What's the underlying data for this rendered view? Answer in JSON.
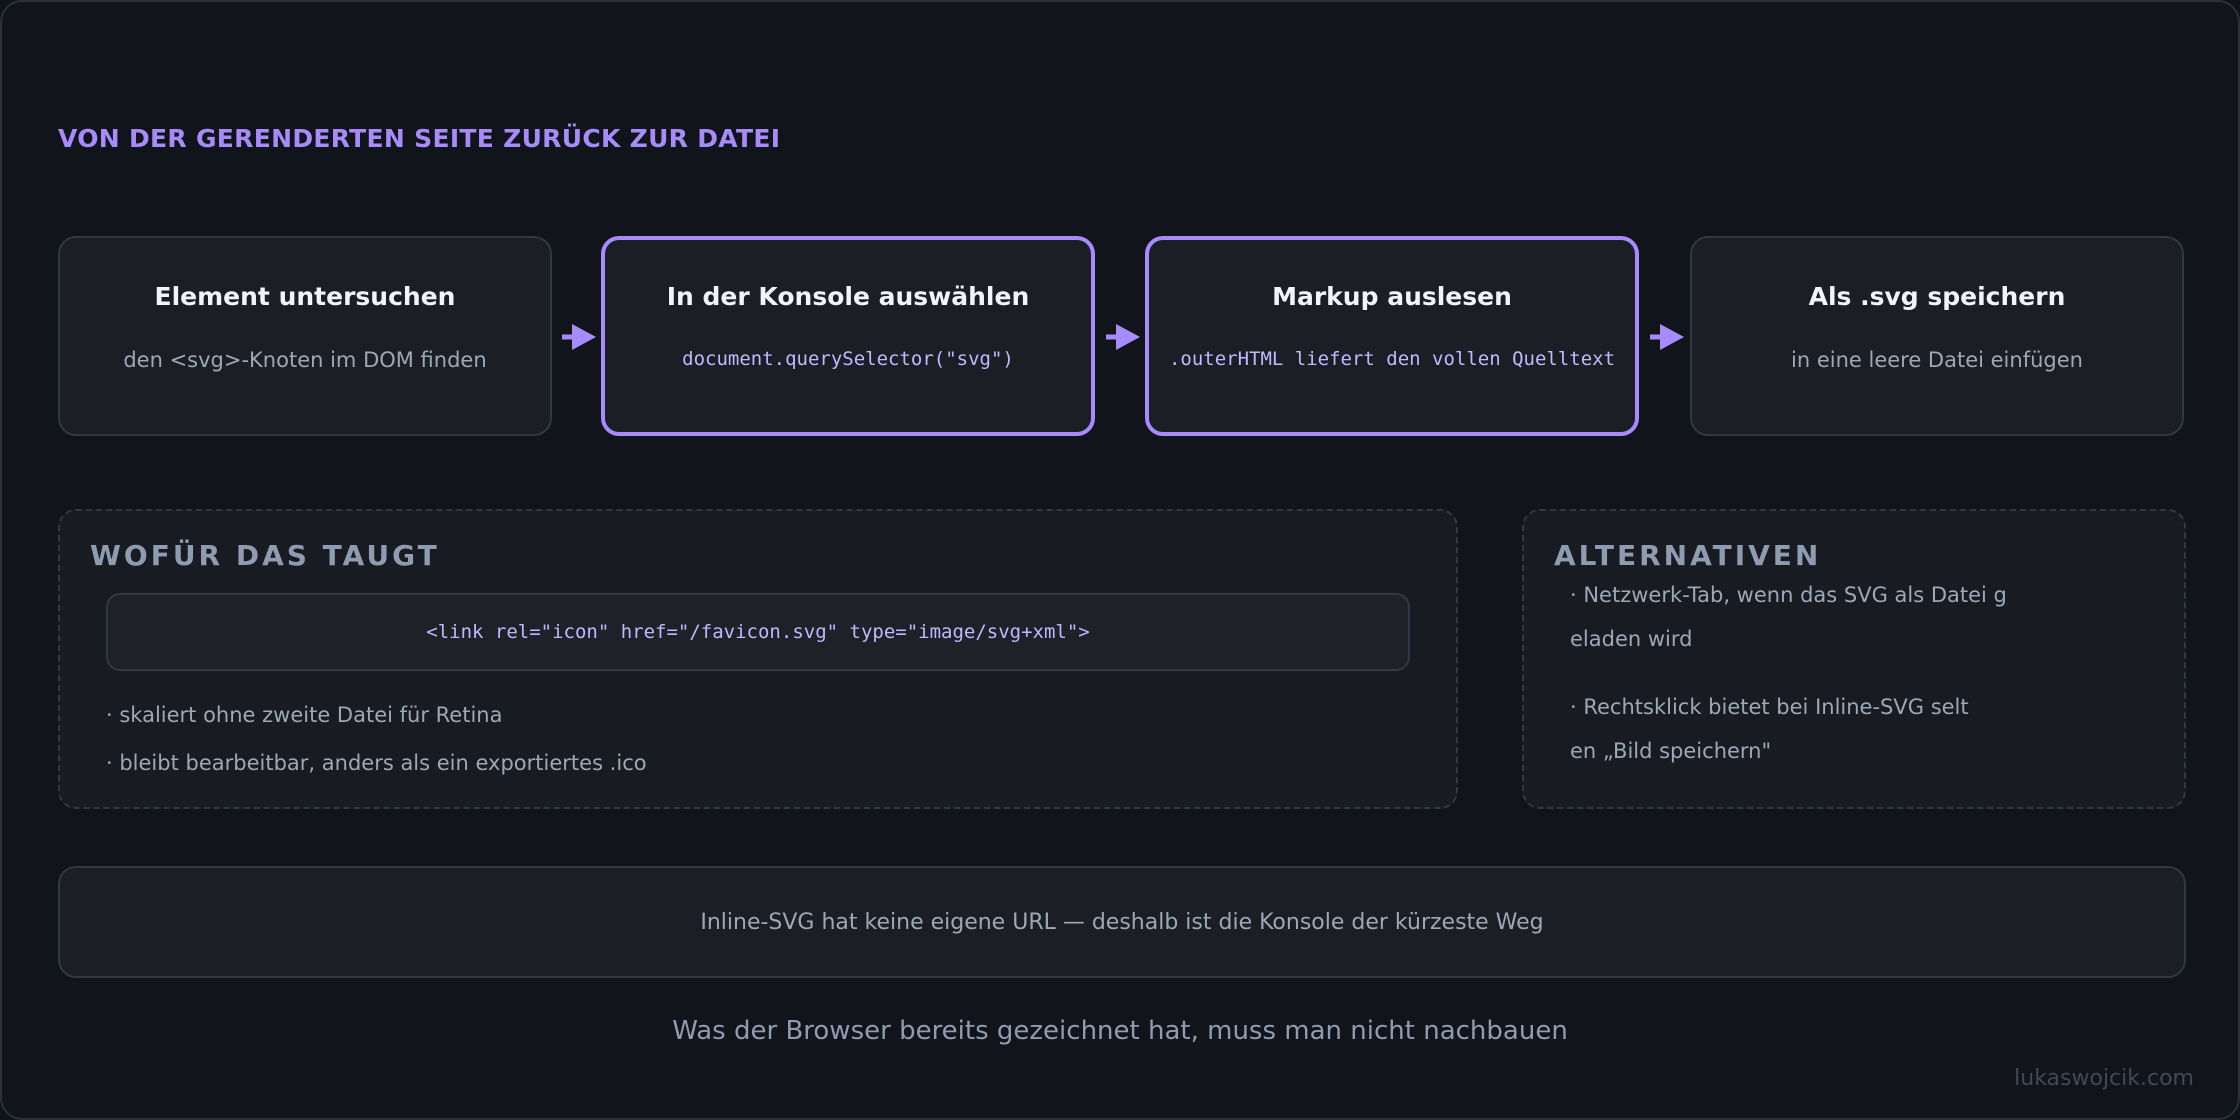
{
  "heading": "VON DER GERENDERTEN SEITE ZURÜCK ZUR DATEI",
  "steps": [
    {
      "title": "Element untersuchen",
      "desc": "den <svg>-Knoten im DOM finden"
    },
    {
      "title": "In der Konsole auswählen",
      "desc": "document.querySelector(\"svg\")"
    },
    {
      "title": "Markup auslesen",
      "desc": ".outerHTML liefert den vollen Quelltext"
    },
    {
      "title": "Als .svg speichern",
      "desc": "in eine leere Datei einfügen"
    }
  ],
  "uses": {
    "title": "WOFÜR DAS TAUGT",
    "code": "<link rel=\"icon\" href=\"/favicon.svg\" type=\"image/svg+xml\">",
    "bullets": [
      "· skaliert ohne zweite Datei für Retina",
      "· bleibt bearbeitbar, anders als ein exportiertes .ico"
    ]
  },
  "alternatives": {
    "title": "ALTERNATIVEN",
    "lines": [
      "· Netzwerk-Tab, wenn das SVG als Datei g",
      "eladen wird",
      "· Rechtsklick bietet bei Inline-SVG selt",
      "en „Bild speichern\""
    ]
  },
  "note": "Inline-SVG hat keine eigene URL — deshalb ist die Konsole der kürzeste Weg",
  "caption": "Was der Browser bereits gezeichnet hat, muss man nicht nachbauen",
  "credit": "lukaswojcik.com",
  "colors": {
    "background": "#11151b",
    "accent": "#a78bfa",
    "card": "#1b1f25",
    "border": "#323843",
    "text": "#9ca8b6"
  }
}
